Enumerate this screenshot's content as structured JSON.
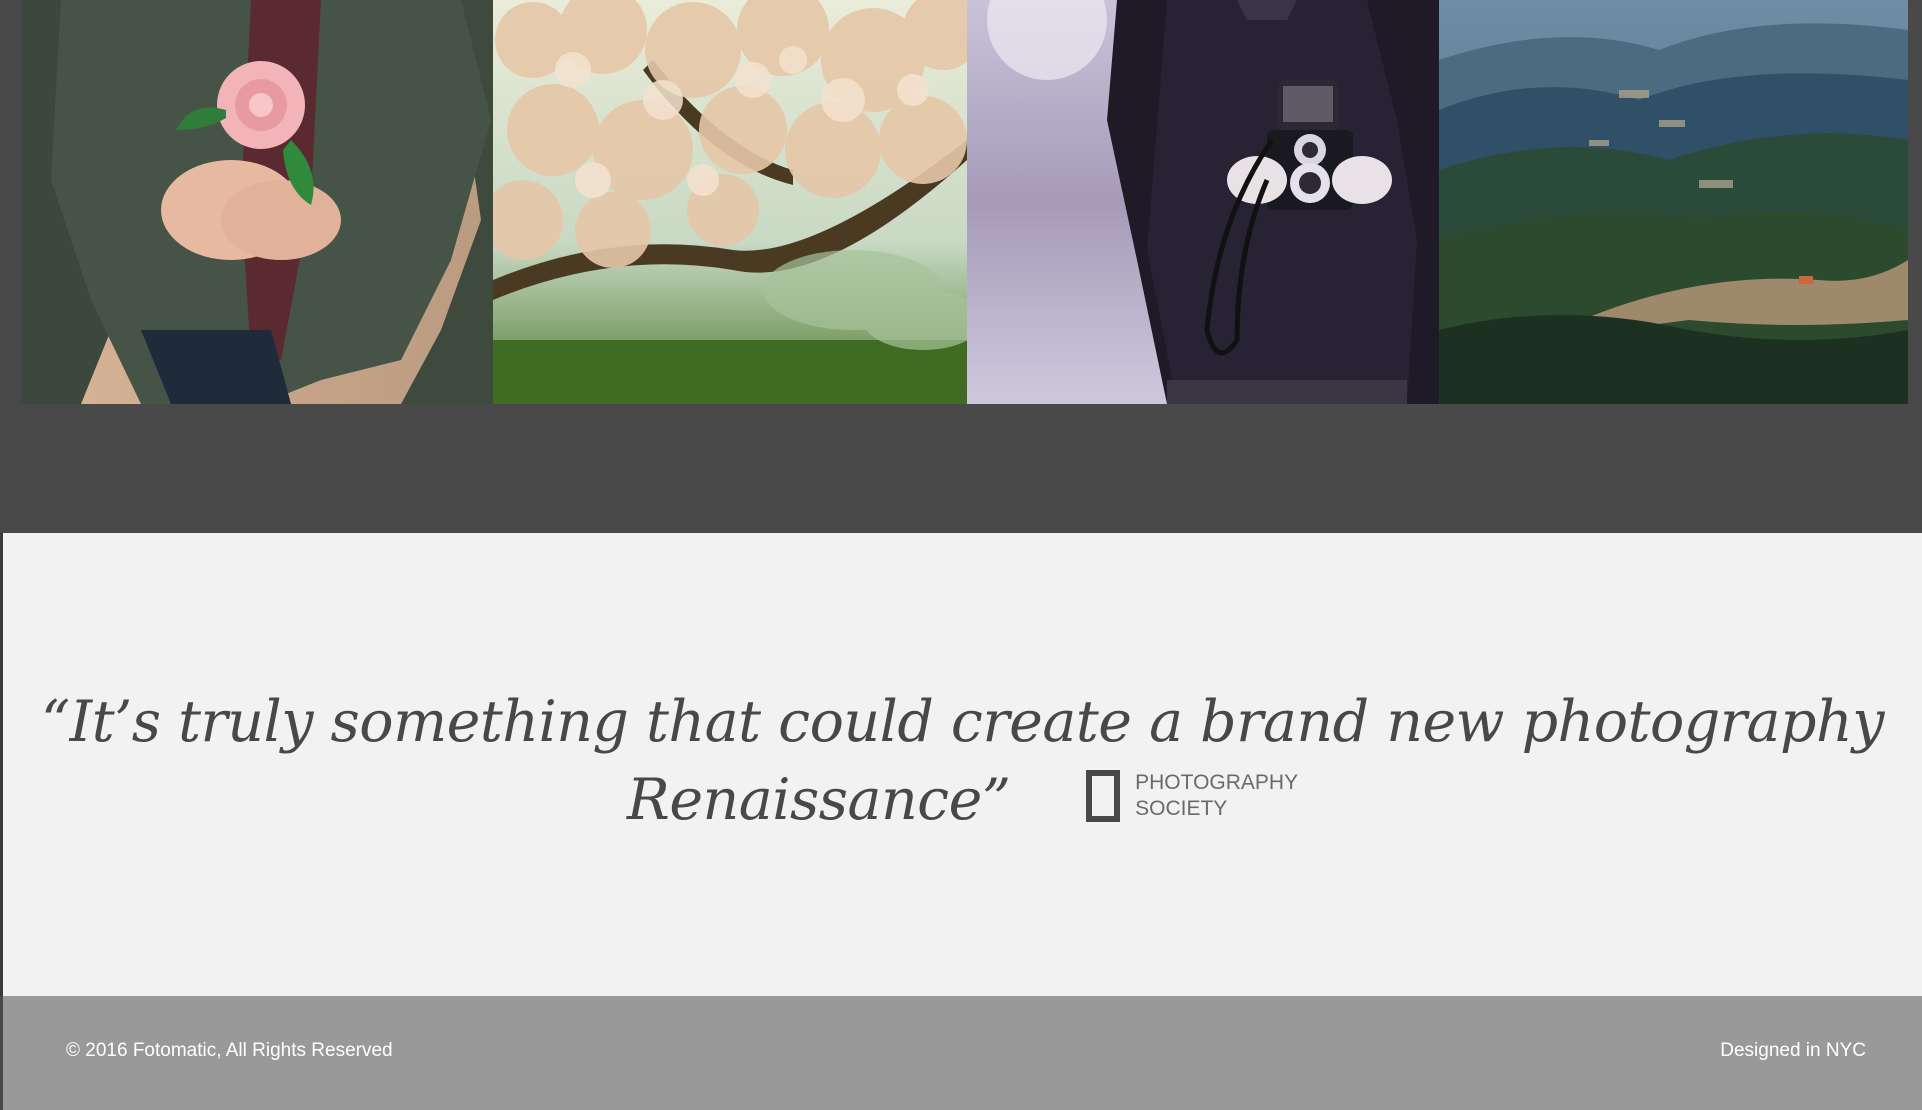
{
  "gallery": {
    "photos": [
      {
        "icon": "photo-woman-holding-rose"
      },
      {
        "icon": "photo-blossoming-tree"
      },
      {
        "icon": "photo-person-with-camera"
      },
      {
        "icon": "photo-mountain-landscape"
      }
    ]
  },
  "testimonial": {
    "quote_line1": "“It’s truly something that could create a brand new photography",
    "quote_line2": "Renaissance”",
    "source_line1": "PHOTOGRAPHY",
    "source_line2": "SOCIETY"
  },
  "footer": {
    "copyright": "© 2016 Fotomatic, All Rights Reserved",
    "credit": "Designed in NYC"
  },
  "colors": {
    "dark_band": "#494949",
    "quote_bg": "#f2f2f2",
    "quote_text": "#484848",
    "footer_bg": "#999999"
  }
}
